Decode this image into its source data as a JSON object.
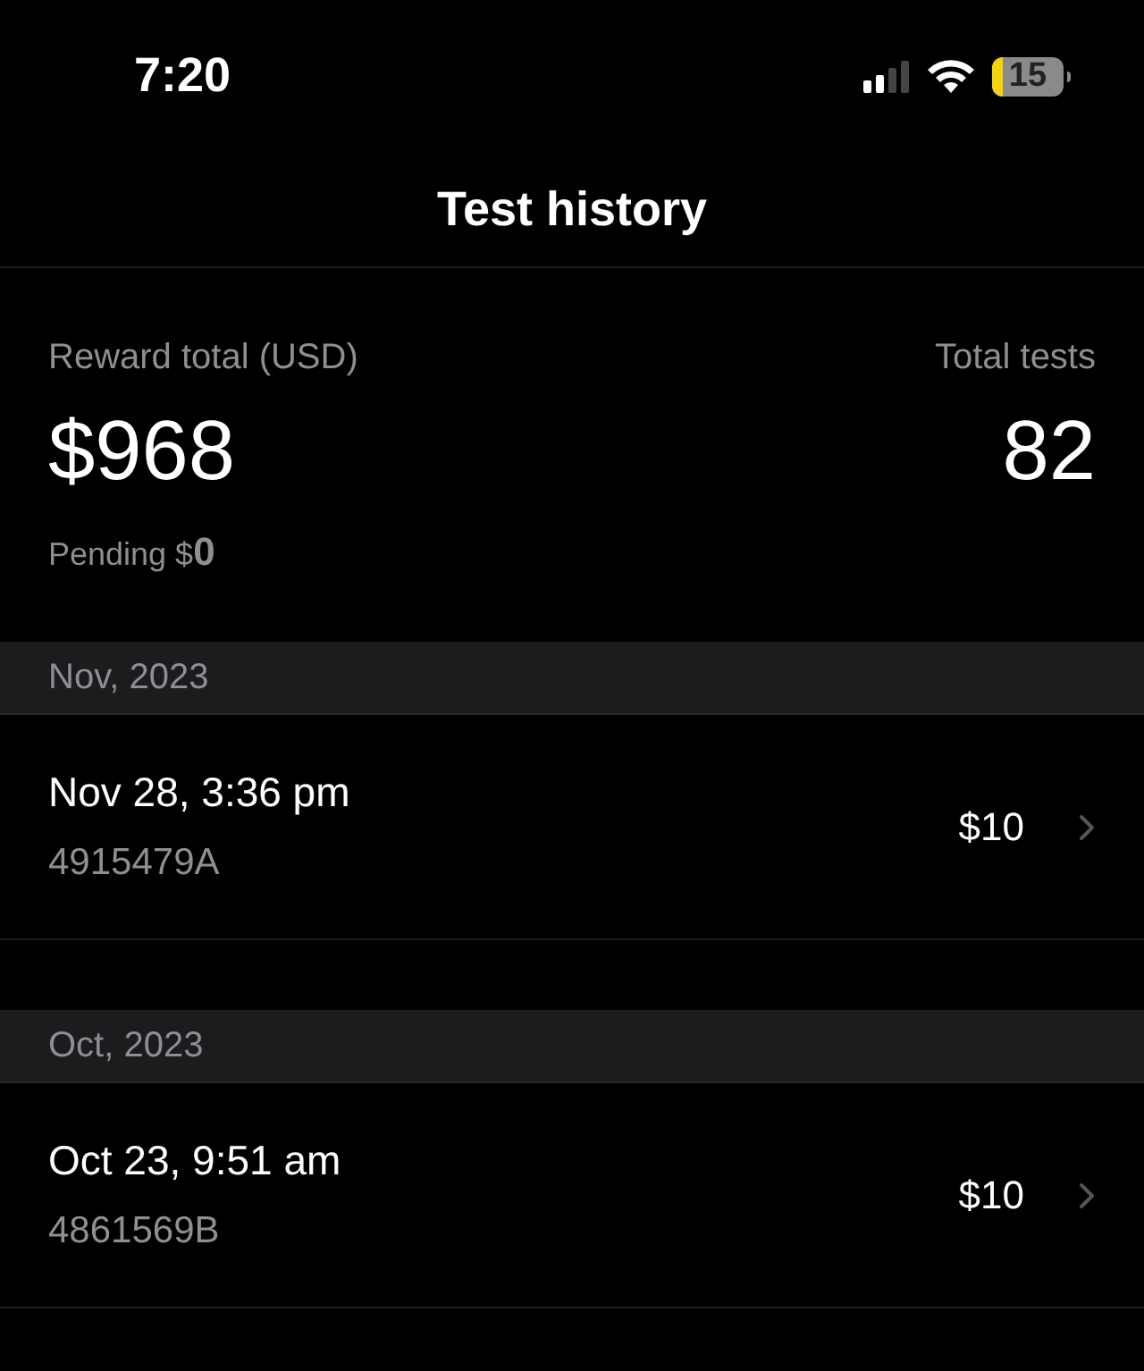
{
  "status_bar": {
    "time": "7:20",
    "battery": "15"
  },
  "title": "Test history",
  "summary": {
    "reward_label": "Reward total (USD)",
    "reward_value": "$968",
    "pending": "Pending $**0**",
    "tests_label": "Total tests",
    "tests_value": "82"
  },
  "sections": [
    {
      "header": "Nov, 2023",
      "rows": [
        {
          "date": "Nov 28, 3:36 pm",
          "code": "4915479A",
          "amount": "$10"
        }
      ]
    },
    {
      "header": "Oct, 2023",
      "rows": [
        {
          "date": "Oct 23, 9:51 am",
          "code": "4861569B",
          "amount": "$10"
        }
      ]
    }
  ]
}
